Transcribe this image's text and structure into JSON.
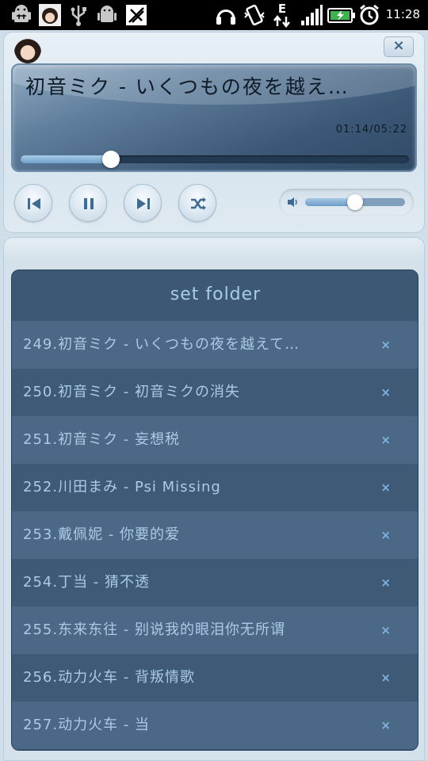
{
  "status_bar": {
    "time": "11:28",
    "left_icons": [
      "android-debug-icon",
      "avatar-notification-icon",
      "usb-icon",
      "android-icon",
      "sd-card-icon"
    ],
    "right_icons": [
      "headphones-icon",
      "vibrate-icon",
      "data-edge-icon",
      "signal-icon",
      "battery-charging-icon",
      "alarm-icon"
    ],
    "network_letter": "E"
  },
  "player": {
    "close_label": "×",
    "now_playing_title": "初音ミク - いくつもの夜を越え…",
    "time_display": "01:14/05:22",
    "progress_fraction": 0.233,
    "volume_fraction": 0.5,
    "controls": [
      "previous-button",
      "pause-button",
      "next-button",
      "shuffle-button"
    ]
  },
  "playlist": {
    "header_label": "set folder",
    "remove_label": "×",
    "items": [
      {
        "label": "249.初音ミク - いくつもの夜を越えて…"
      },
      {
        "label": "250.初音ミク - 初音ミクの消失"
      },
      {
        "label": "251.初音ミク - 妄想税"
      },
      {
        "label": "252.川田まみ - Psi Missing"
      },
      {
        "label": "253.戴佩妮 - 你要的爱"
      },
      {
        "label": "254.丁当 - 猜不透"
      },
      {
        "label": "255.东来东往 - 别说我的眼泪你无所谓"
      },
      {
        "label": "256.动力火车 - 背叛情歌"
      },
      {
        "label": "257.动力火车 - 当"
      }
    ]
  },
  "colors": {
    "accent": "#a9cbe5",
    "list_row_light": "#4b6887",
    "list_row_dark": "#3f5a77",
    "screen": "#3c5877"
  }
}
